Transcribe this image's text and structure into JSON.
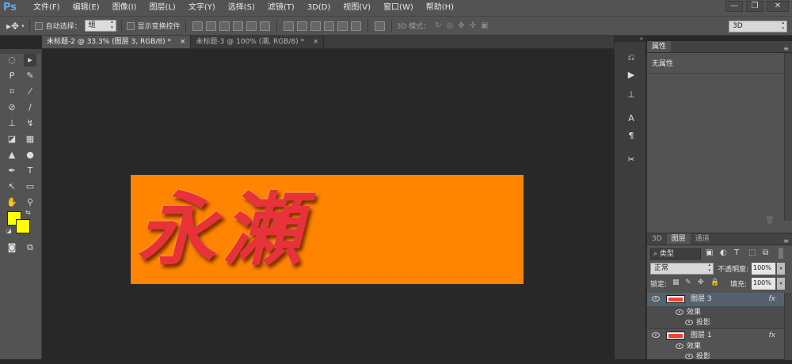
{
  "app": {
    "logo": "Ps"
  },
  "menu": [
    "文件(F)",
    "编辑(E)",
    "图像(I)",
    "图层(L)",
    "文字(Y)",
    "选择(S)",
    "滤镜(T)",
    "3D(D)",
    "视图(V)",
    "窗口(W)",
    "帮助(H)"
  ],
  "window_controls": {
    "minimize": "—",
    "restore": "❐",
    "close": "✕"
  },
  "options": {
    "auto_select_label": "自动选择：",
    "auto_select_value": "组",
    "show_transform_label": "显示变换控件",
    "mode3d_label": "3D 模式：",
    "workspace_value": "3D"
  },
  "tabs": [
    {
      "label": "未标题-2 @ 33.3% (图层 3, RGB/8) *",
      "close": "×"
    },
    {
      "label": "未标题-3 @ 100% (潮, RGB/8) *",
      "close": "×"
    }
  ],
  "colors": {
    "foreground": "#ffff00",
    "background": "#ffff00",
    "canvas": "#ff8400",
    "text_fill": "#e8323a"
  },
  "artwork": {
    "text": "永瀬"
  },
  "properties": {
    "tab": "属性",
    "content": "无属性"
  },
  "layers_panel": {
    "tabs": [
      "3D",
      "图层",
      "通道"
    ],
    "filter_kind": "类型",
    "blend_mode": "正常",
    "opacity_label": "不透明度:",
    "opacity_value": "100%",
    "lock_label": "锁定:",
    "fill_label": "填充:",
    "fill_value": "100%",
    "layers": [
      {
        "name": "图层 3",
        "fx": "fx",
        "effects_label": "效果",
        "shadow_label": "投影"
      },
      {
        "name": "图层 1",
        "fx": "fx",
        "effects_label": "效果",
        "shadow_label": "投影"
      }
    ]
  }
}
